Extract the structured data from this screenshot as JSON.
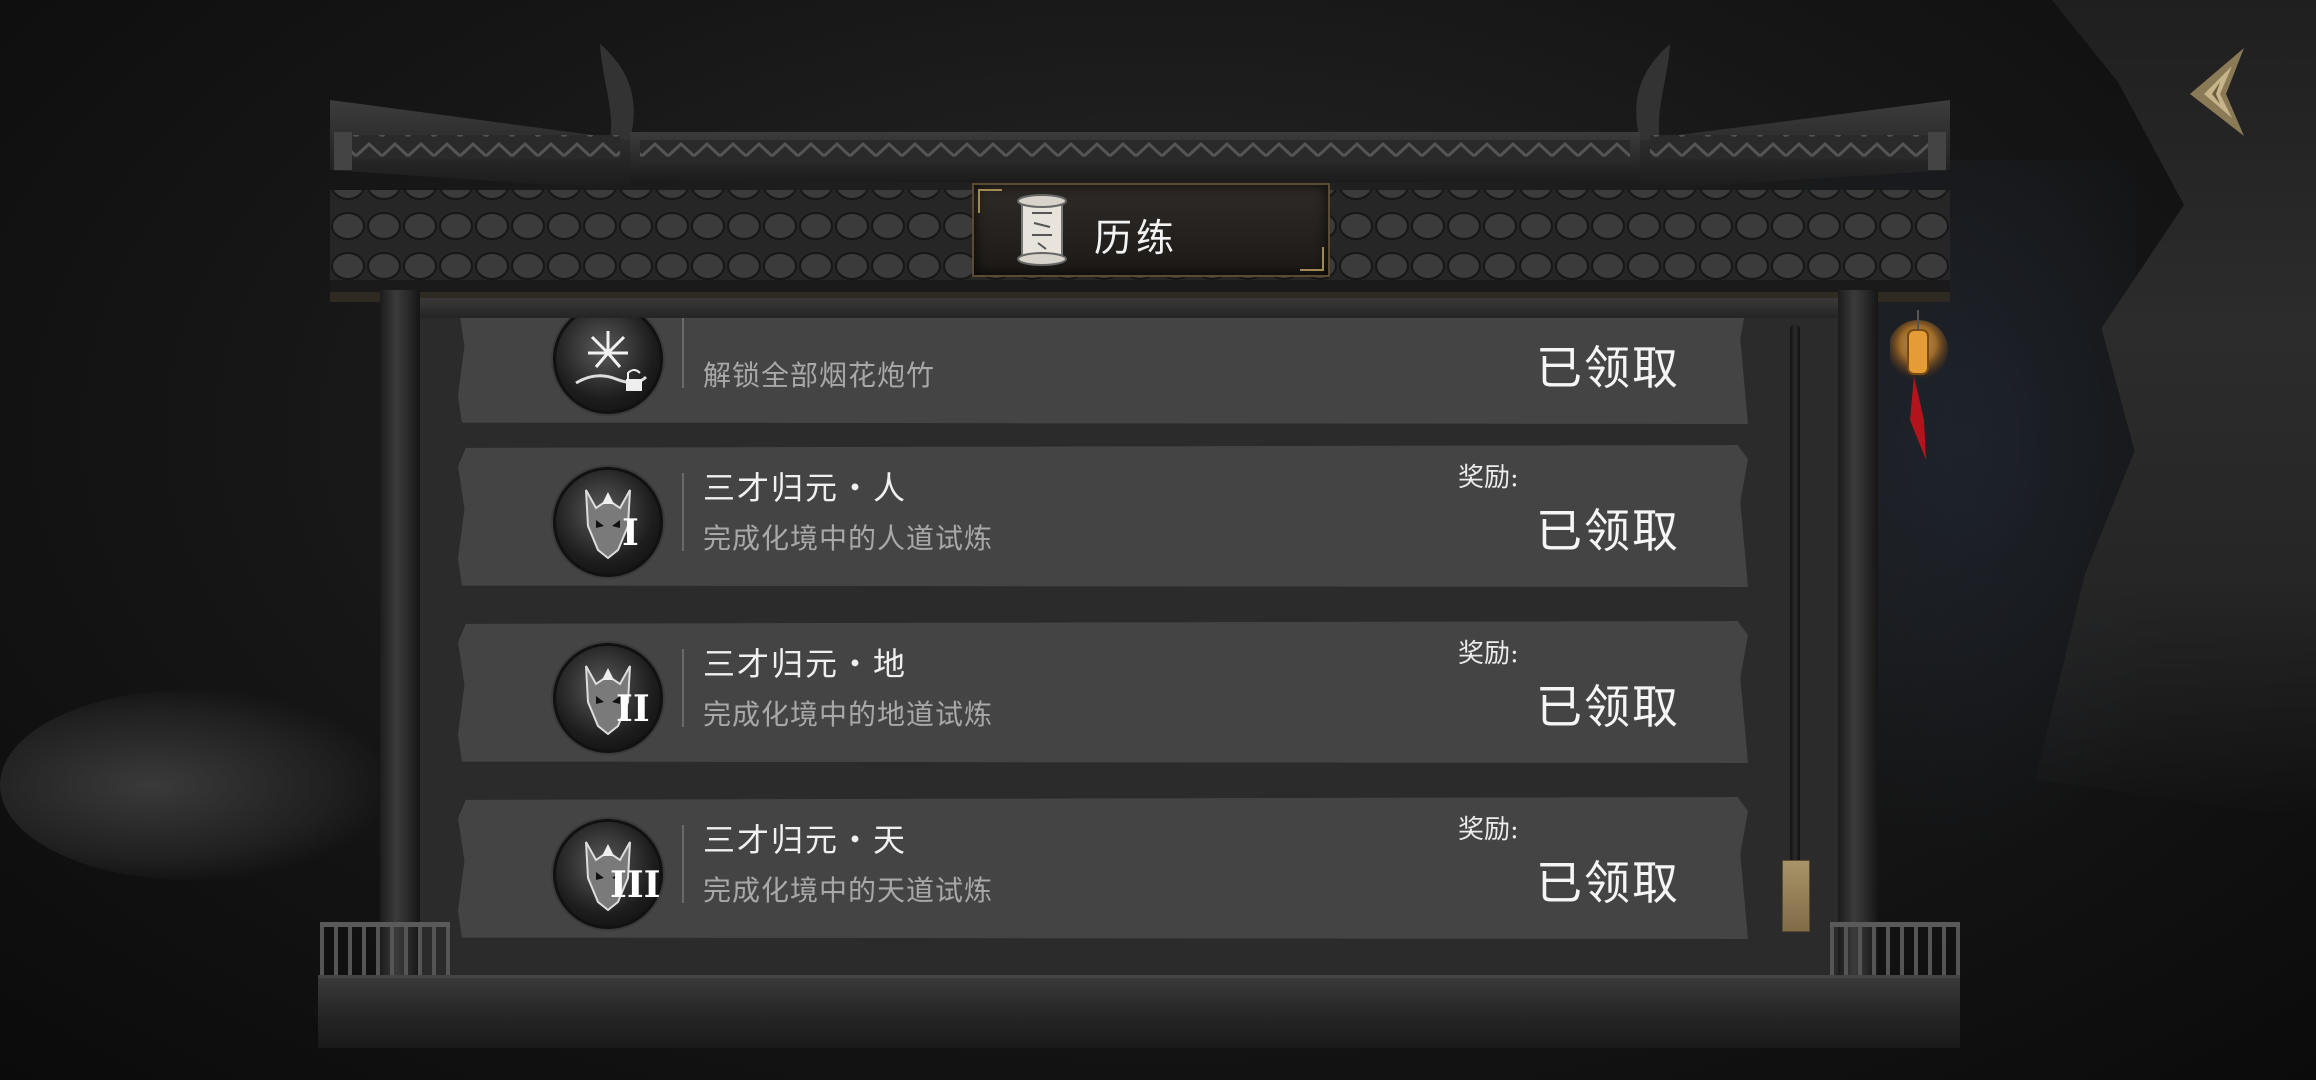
{
  "header": {
    "title": "历练"
  },
  "achievements": [
    {
      "title": "",
      "description": "解锁全部烟花炮竹",
      "reward_label": "",
      "status": "已领取",
      "badge_icon": "fireworks-icon"
    },
    {
      "title": "三才归元・人",
      "description": "完成化境中的人道试炼",
      "reward_label": "奖励:",
      "status": "已领取",
      "badge_icon": "demon-mask-icon",
      "badge_numeral": "I"
    },
    {
      "title": "三才归元・地",
      "description": "完成化境中的地道试炼",
      "reward_label": "奖励:",
      "status": "已领取",
      "badge_icon": "demon-mask-icon",
      "badge_numeral": "II"
    },
    {
      "title": "三才归元・天",
      "description": "完成化境中的天道试炼",
      "reward_label": "奖励:",
      "status": "已领取",
      "badge_icon": "demon-mask-icon",
      "badge_numeral": "III"
    }
  ],
  "colors": {
    "card_bg": "#444444",
    "accent_gold": "#a89468",
    "lantern_glow": "#f2a23a",
    "tassel_red": "#b3141c"
  }
}
